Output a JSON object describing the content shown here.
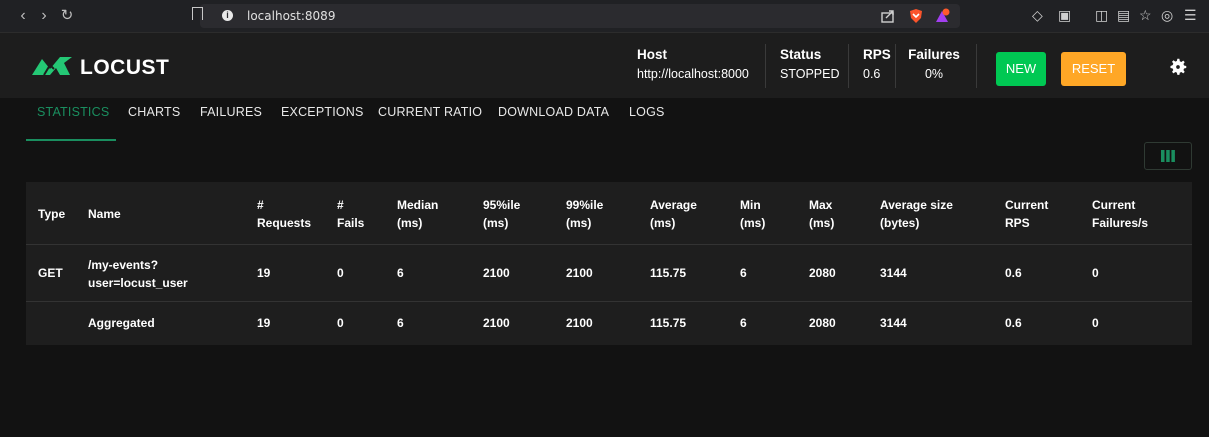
{
  "browser": {
    "url": "localhost:8089"
  },
  "header": {
    "logo_text": "LOCUST",
    "host_label": "Host",
    "host_value": "http://localhost:8000",
    "status_label": "Status",
    "status_value": "STOPPED",
    "rps_label": "RPS",
    "rps_value": "0.6",
    "failures_label": "Failures",
    "failures_value": "0%",
    "new_label": "NEW",
    "reset_label": "RESET"
  },
  "tabs": [
    "STATISTICS",
    "CHARTS",
    "FAILURES",
    "EXCEPTIONS",
    "CURRENT RATIO",
    "DOWNLOAD DATA",
    "LOGS"
  ],
  "table": {
    "headers": [
      [
        "Type"
      ],
      [
        "Name"
      ],
      [
        "#",
        "Requests"
      ],
      [
        "#",
        "Fails"
      ],
      [
        "Median",
        "(ms)"
      ],
      [
        "95%ile",
        "(ms)"
      ],
      [
        "99%ile",
        "(ms)"
      ],
      [
        "Average",
        "(ms)"
      ],
      [
        "Min",
        "(ms)"
      ],
      [
        "Max",
        "(ms)"
      ],
      [
        "Average size",
        "(bytes)"
      ],
      [
        "Current",
        "RPS"
      ],
      [
        "Current",
        "Failures/s"
      ]
    ],
    "rows": [
      {
        "type": "GET",
        "name_line1": "/my-events?",
        "name_line2": "user=locust_user",
        "requests": "19",
        "fails": "0",
        "median": "6",
        "p95": "2100",
        "p99": "2100",
        "average": "115.75",
        "min": "6",
        "max": "2080",
        "avg_size": "3144",
        "current_rps": "0.6",
        "current_failures": "0"
      },
      {
        "type": "",
        "name_line1": "Aggregated",
        "name_line2": "",
        "requests": "19",
        "fails": "0",
        "median": "6",
        "p95": "2100",
        "p99": "2100",
        "average": "115.75",
        "min": "6",
        "max": "2080",
        "avg_size": "3144",
        "current_rps": "0.6",
        "current_failures": "0"
      }
    ]
  },
  "colors": {
    "accent": "#1a8e5f",
    "new_button": "#00c853",
    "reset_button": "#ffa726"
  }
}
